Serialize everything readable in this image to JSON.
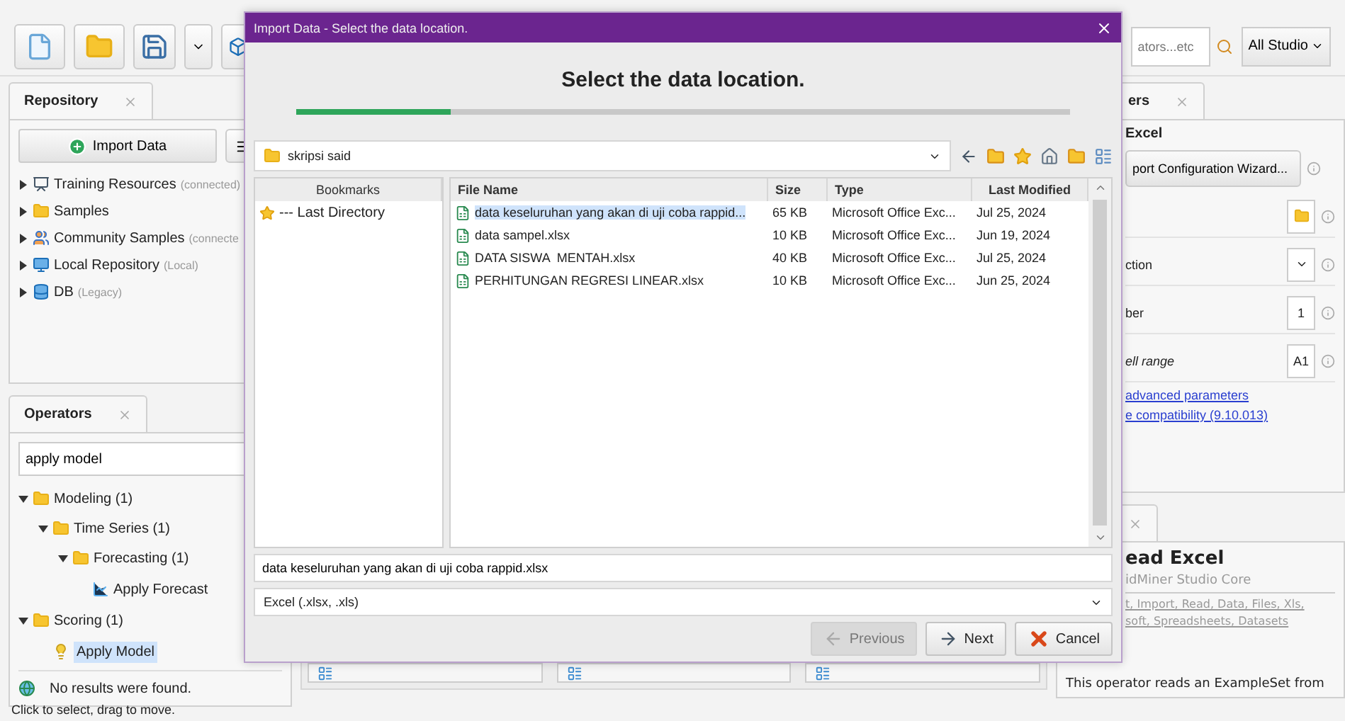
{
  "toolbar": {
    "search": {
      "placeholder": "ators...etc"
    },
    "scope_button": "All Studio"
  },
  "repository_panel": {
    "tab": {
      "label": "Repository",
      "selected": true
    },
    "import_button": "Import Data",
    "items": [
      {
        "kind": "training",
        "label": "Training Resources",
        "note": "(connected)",
        "expanded": false
      },
      {
        "kind": "folder",
        "label": "Samples",
        "expanded": false
      },
      {
        "kind": "community",
        "label": "Community Samples",
        "note": "(connecte",
        "expanded": false
      },
      {
        "kind": "local",
        "label": "Local Repository",
        "note": "(Local)",
        "expanded": false
      },
      {
        "kind": "database",
        "label": "DB",
        "note": "(Legacy)",
        "expanded": false
      }
    ]
  },
  "operators_panel": {
    "tab": {
      "label": "Operators",
      "selected": true
    },
    "search": {
      "value": "apply model"
    },
    "tree": [
      {
        "kind": "folder",
        "label": "Modeling (1)",
        "expanded": true,
        "selected": false,
        "children": [
          {
            "kind": "folder",
            "label": "Time Series (1)",
            "expanded": true,
            "selected": false,
            "children": [
              {
                "kind": "folder",
                "label": "Forecasting (1)",
                "expanded": true,
                "selected": false,
                "children": [
                  {
                    "kind": "forecast",
                    "label": "Apply Forecast",
                    "selected": false
                  }
                ]
              }
            ]
          }
        ]
      },
      {
        "kind": "folder",
        "label": "Scoring (1)",
        "expanded": true,
        "selected": false,
        "children": [
          {
            "kind": "model",
            "label": "Apply Model",
            "selected": true
          }
        ]
      }
    ],
    "status": "No results were found."
  },
  "process_cards": [
    {
      "kind": "operator"
    },
    {
      "kind": "operator"
    },
    {
      "kind": "operator"
    }
  ],
  "parameters_panel": {
    "tab": {
      "label": "ers",
      "selected": true
    },
    "heading": "Excel",
    "wizard_button": "port Configuration Wizard...",
    "rows": [
      {
        "kind": "file"
      },
      {
        "kind": "dropdown",
        "label": "ction"
      },
      {
        "kind": "text",
        "label": "ber",
        "value": "1"
      },
      {
        "kind": "text",
        "label": "ell range",
        "value": "A1"
      }
    ],
    "links": [
      "advanced parameters",
      "e compatibility (9.10.013)"
    ]
  },
  "help_panel": {
    "tab": {
      "selected": true
    },
    "title": "ead Excel",
    "subtitle": "idMiner Studio Core",
    "tags": [
      "t, Import, Read, Data, Files, Xls,",
      "soft, Spreadsheets, Datasets"
    ],
    "description": "This operator reads an ExampleSet from"
  },
  "status_bar": "Click to select, drag to move.",
  "dialog": {
    "title": "Import Data - Select the data location.",
    "heading": "Select the data location.",
    "progress": {
      "level": 0.2
    },
    "location": {
      "value": "skripsi said"
    },
    "bookmarks": {
      "header": "Bookmarks",
      "items": [
        {
          "label": "--- Last Directory"
        }
      ]
    },
    "files": {
      "columns": [
        "File Name",
        "Size",
        "Type",
        "Last Modified"
      ],
      "rows": [
        {
          "cells": [
            "data keseluruhan yang akan di uji coba rappid...",
            "65 KB",
            "Microsoft Office Exc...",
            "Jul 25, 2024"
          ],
          "selected": true
        },
        {
          "cells": [
            "data sampel.xlsx",
            "10 KB",
            "Microsoft Office Exc...",
            "Jun 19, 2024"
          ],
          "selected": false
        },
        {
          "cells": [
            "DATA SISWA  MENTAH.xlsx",
            "40 KB",
            "Microsoft Office Exc...",
            "Jul 25, 2024"
          ],
          "selected": false
        },
        {
          "cells": [
            "PERHITUNGAN REGRESI LINEAR.xlsx",
            "10 KB",
            "Microsoft Office Exc...",
            "Jun 25, 2024"
          ],
          "selected": false
        }
      ]
    },
    "file_name": {
      "value": "data keseluruhan yang akan di uji coba rappid.xlsx"
    },
    "file_type": {
      "value": "Excel (.xlsx, .xls)"
    },
    "buttons": [
      {
        "kind": "previous",
        "label": "Previous",
        "disabled": true
      },
      {
        "kind": "next",
        "label": "Next",
        "disabled": false
      },
      {
        "kind": "cancel",
        "label": "Cancel",
        "disabled": false
      }
    ]
  }
}
